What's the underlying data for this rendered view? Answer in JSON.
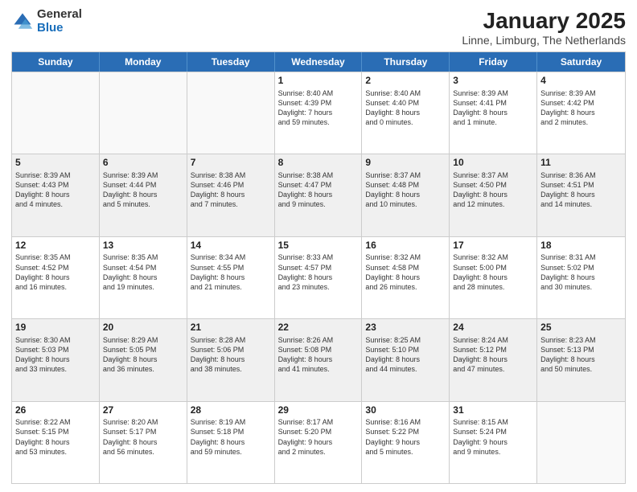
{
  "logo": {
    "general": "General",
    "blue": "Blue"
  },
  "title": "January 2025",
  "subtitle": "Linne, Limburg, The Netherlands",
  "days_of_week": [
    "Sunday",
    "Monday",
    "Tuesday",
    "Wednesday",
    "Thursday",
    "Friday",
    "Saturday"
  ],
  "rows": [
    [
      {
        "day": "",
        "text": "",
        "empty": true
      },
      {
        "day": "",
        "text": "",
        "empty": true
      },
      {
        "day": "",
        "text": "",
        "empty": true
      },
      {
        "day": "1",
        "text": "Sunrise: 8:40 AM\nSunset: 4:39 PM\nDaylight: 7 hours\nand 59 minutes."
      },
      {
        "day": "2",
        "text": "Sunrise: 8:40 AM\nSunset: 4:40 PM\nDaylight: 8 hours\nand 0 minutes."
      },
      {
        "day": "3",
        "text": "Sunrise: 8:39 AM\nSunset: 4:41 PM\nDaylight: 8 hours\nand 1 minute."
      },
      {
        "day": "4",
        "text": "Sunrise: 8:39 AM\nSunset: 4:42 PM\nDaylight: 8 hours\nand 2 minutes."
      }
    ],
    [
      {
        "day": "5",
        "text": "Sunrise: 8:39 AM\nSunset: 4:43 PM\nDaylight: 8 hours\nand 4 minutes."
      },
      {
        "day": "6",
        "text": "Sunrise: 8:39 AM\nSunset: 4:44 PM\nDaylight: 8 hours\nand 5 minutes."
      },
      {
        "day": "7",
        "text": "Sunrise: 8:38 AM\nSunset: 4:46 PM\nDaylight: 8 hours\nand 7 minutes."
      },
      {
        "day": "8",
        "text": "Sunrise: 8:38 AM\nSunset: 4:47 PM\nDaylight: 8 hours\nand 9 minutes."
      },
      {
        "day": "9",
        "text": "Sunrise: 8:37 AM\nSunset: 4:48 PM\nDaylight: 8 hours\nand 10 minutes."
      },
      {
        "day": "10",
        "text": "Sunrise: 8:37 AM\nSunset: 4:50 PM\nDaylight: 8 hours\nand 12 minutes."
      },
      {
        "day": "11",
        "text": "Sunrise: 8:36 AM\nSunset: 4:51 PM\nDaylight: 8 hours\nand 14 minutes."
      }
    ],
    [
      {
        "day": "12",
        "text": "Sunrise: 8:35 AM\nSunset: 4:52 PM\nDaylight: 8 hours\nand 16 minutes."
      },
      {
        "day": "13",
        "text": "Sunrise: 8:35 AM\nSunset: 4:54 PM\nDaylight: 8 hours\nand 19 minutes."
      },
      {
        "day": "14",
        "text": "Sunrise: 8:34 AM\nSunset: 4:55 PM\nDaylight: 8 hours\nand 21 minutes."
      },
      {
        "day": "15",
        "text": "Sunrise: 8:33 AM\nSunset: 4:57 PM\nDaylight: 8 hours\nand 23 minutes."
      },
      {
        "day": "16",
        "text": "Sunrise: 8:32 AM\nSunset: 4:58 PM\nDaylight: 8 hours\nand 26 minutes."
      },
      {
        "day": "17",
        "text": "Sunrise: 8:32 AM\nSunset: 5:00 PM\nDaylight: 8 hours\nand 28 minutes."
      },
      {
        "day": "18",
        "text": "Sunrise: 8:31 AM\nSunset: 5:02 PM\nDaylight: 8 hours\nand 30 minutes."
      }
    ],
    [
      {
        "day": "19",
        "text": "Sunrise: 8:30 AM\nSunset: 5:03 PM\nDaylight: 8 hours\nand 33 minutes."
      },
      {
        "day": "20",
        "text": "Sunrise: 8:29 AM\nSunset: 5:05 PM\nDaylight: 8 hours\nand 36 minutes."
      },
      {
        "day": "21",
        "text": "Sunrise: 8:28 AM\nSunset: 5:06 PM\nDaylight: 8 hours\nand 38 minutes."
      },
      {
        "day": "22",
        "text": "Sunrise: 8:26 AM\nSunset: 5:08 PM\nDaylight: 8 hours\nand 41 minutes."
      },
      {
        "day": "23",
        "text": "Sunrise: 8:25 AM\nSunset: 5:10 PM\nDaylight: 8 hours\nand 44 minutes."
      },
      {
        "day": "24",
        "text": "Sunrise: 8:24 AM\nSunset: 5:12 PM\nDaylight: 8 hours\nand 47 minutes."
      },
      {
        "day": "25",
        "text": "Sunrise: 8:23 AM\nSunset: 5:13 PM\nDaylight: 8 hours\nand 50 minutes."
      }
    ],
    [
      {
        "day": "26",
        "text": "Sunrise: 8:22 AM\nSunset: 5:15 PM\nDaylight: 8 hours\nand 53 minutes."
      },
      {
        "day": "27",
        "text": "Sunrise: 8:20 AM\nSunset: 5:17 PM\nDaylight: 8 hours\nand 56 minutes."
      },
      {
        "day": "28",
        "text": "Sunrise: 8:19 AM\nSunset: 5:18 PM\nDaylight: 8 hours\nand 59 minutes."
      },
      {
        "day": "29",
        "text": "Sunrise: 8:17 AM\nSunset: 5:20 PM\nDaylight: 9 hours\nand 2 minutes."
      },
      {
        "day": "30",
        "text": "Sunrise: 8:16 AM\nSunset: 5:22 PM\nDaylight: 9 hours\nand 5 minutes."
      },
      {
        "day": "31",
        "text": "Sunrise: 8:15 AM\nSunset: 5:24 PM\nDaylight: 9 hours\nand 9 minutes."
      },
      {
        "day": "",
        "text": "",
        "empty": true
      }
    ]
  ]
}
